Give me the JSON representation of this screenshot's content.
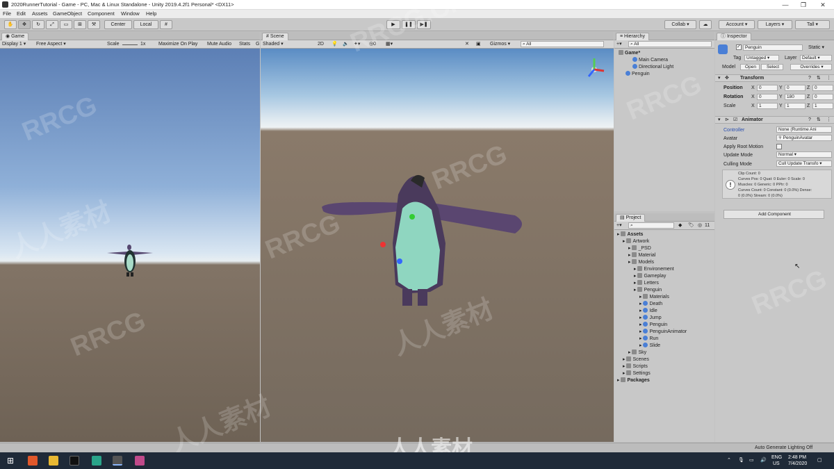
{
  "window": {
    "title": "2020RunnerTutorial - Game - PC, Mac & Linux Standalone - Unity 2019.4.2f1 Personal* <DX11>"
  },
  "menu": [
    "File",
    "Edit",
    "Assets",
    "GameObject",
    "Component",
    "Window",
    "Help"
  ],
  "toolbar": {
    "center": "Center",
    "local": "Local",
    "collab": "Collab ▾",
    "account": "Account ▾",
    "layers": "Layers ▾",
    "layout": "Tall ▾"
  },
  "game": {
    "tab": "Game",
    "display": "Display 1 ▾",
    "aspect": "Free Aspect ▾",
    "scale_label": "Scale",
    "scale_value": "1x",
    "maximize": "Maximize On Play",
    "mute": "Mute Audio",
    "stats": "Stats",
    "gizmos": "G"
  },
  "scene": {
    "tab": "Scene",
    "shading": "Shaded ▾",
    "mode2d": "2D",
    "gizmos": "Gizmos ▾",
    "search": "All"
  },
  "hierarchy": {
    "tab": "Hierarchy",
    "search": "All",
    "items": [
      {
        "label": "Game*",
        "indent": 0
      },
      {
        "label": "Main Camera",
        "indent": 2
      },
      {
        "label": "Directional Light",
        "indent": 2
      },
      {
        "label": "Penguin",
        "indent": 1
      }
    ]
  },
  "project": {
    "tab": "Project",
    "count": "11",
    "items": [
      {
        "label": "Assets",
        "indent": 0,
        "bold": true
      },
      {
        "label": "Artwork",
        "indent": 1
      },
      {
        "label": "_PSD",
        "indent": 2
      },
      {
        "label": "Material",
        "indent": 2
      },
      {
        "label": "Models",
        "indent": 2
      },
      {
        "label": "Environement",
        "indent": 3
      },
      {
        "label": "Gameplay",
        "indent": 3
      },
      {
        "label": "Letters",
        "indent": 3
      },
      {
        "label": "Penguin",
        "indent": 3
      },
      {
        "label": "Materials",
        "indent": 4
      },
      {
        "label": "Death",
        "indent": 4
      },
      {
        "label": "Idle",
        "indent": 4
      },
      {
        "label": "Jump",
        "indent": 4
      },
      {
        "label": "Penguin",
        "indent": 4
      },
      {
        "label": "PenguinAnimator",
        "indent": 4
      },
      {
        "label": "Run",
        "indent": 4
      },
      {
        "label": "Slide",
        "indent": 4
      },
      {
        "label": "Sky",
        "indent": 2
      },
      {
        "label": "Scenes",
        "indent": 1
      },
      {
        "label": "Scripts",
        "indent": 1
      },
      {
        "label": "Settings",
        "indent": 1
      },
      {
        "label": "Packages",
        "indent": 0,
        "bold": true
      }
    ]
  },
  "inspector": {
    "tab": "Inspector",
    "name": "Penguin",
    "static": "Static ▾",
    "tag_label": "Tag",
    "tag": "Untagged ▾",
    "layer_label": "Layer",
    "layer": "Default ▾",
    "model_label": "Model",
    "open": "Open",
    "select": "Select",
    "overrides": "Overrides ▾",
    "transform": {
      "title": "Transform",
      "position": "Position",
      "rotation": "Rotation",
      "scale": "Scale",
      "pos": [
        "0",
        "0",
        "0"
      ],
      "rot": [
        "0",
        "180",
        "0"
      ],
      "scl": [
        "1",
        "1",
        "1"
      ],
      "axes": [
        "X",
        "Y",
        "Z"
      ]
    },
    "animator": {
      "title": "Animator",
      "controller_label": "Controller",
      "controller": "None (Runtime Ani",
      "avatar_label": "Avatar",
      "avatar": "PenguinAvatar",
      "root_label": "Apply Root Motion",
      "update_label": "Update Mode",
      "update": "Normal ▾",
      "culling_label": "Culling Mode",
      "culling": "Cull Update Transfo ▾",
      "info": [
        "Clip Count: 0",
        "Curves Pos: 0 Quat: 0 Euler: 0 Scale: 0",
        "Muscles: 0 Generic: 0 PPtr: 0",
        "Curves Count: 0 Constant: 0 (0.0%) Dense:",
        "0 (0.0%) Stream: 0 (0.0%)"
      ]
    },
    "add_component": "Add Component"
  },
  "status": {
    "lighting": "Auto Generate Lighting Off"
  },
  "taskbar": {
    "lang": "ENG",
    "region": "US",
    "time": "2:48 PM",
    "date": "7/4/2020"
  },
  "watermarks": [
    "RRCG",
    "人人素材",
    "RRCG.CN"
  ]
}
